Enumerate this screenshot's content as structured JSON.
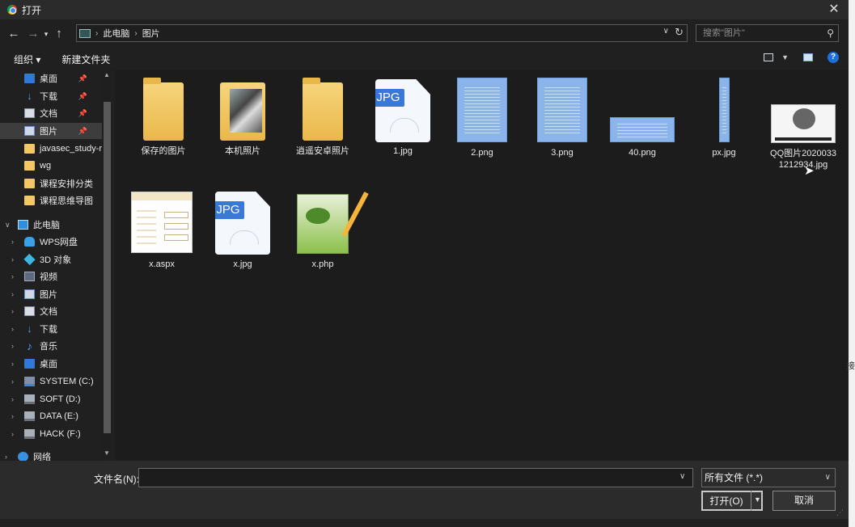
{
  "window": {
    "title": "打开"
  },
  "outside_glyph": "接",
  "address": {
    "crumbs": [
      "此电脑",
      "图片"
    ]
  },
  "search": {
    "placeholder": "搜索\"图片\""
  },
  "toolbar": {
    "organize": "组织 ▾",
    "new_folder": "新建文件夹"
  },
  "sidebar": {
    "quick_access": [
      {
        "label": "桌面",
        "icon": "desktop-icon",
        "pinned": true
      },
      {
        "label": "下载",
        "icon": "download-icon",
        "pinned": true
      },
      {
        "label": "文档",
        "icon": "document-icon",
        "pinned": true
      },
      {
        "label": "图片",
        "icon": "pictures-icon",
        "pinned": true,
        "selected": true
      },
      {
        "label": "javasec_study-r",
        "icon": "folder-icon"
      },
      {
        "label": "wg",
        "icon": "folder-icon"
      },
      {
        "label": "课程安排分类",
        "icon": "folder-icon"
      },
      {
        "label": "课程思维导图",
        "icon": "folder-icon"
      }
    ],
    "this_pc": "此电脑",
    "pc_items": [
      {
        "label": "WPS网盘",
        "icon": "cloud-icon"
      },
      {
        "label": "3D 对象",
        "icon": "3d-objects-icon"
      },
      {
        "label": "视频",
        "icon": "video-icon"
      },
      {
        "label": "图片",
        "icon": "pictures-icon"
      },
      {
        "label": "文档",
        "icon": "document-icon"
      },
      {
        "label": "下载",
        "icon": "download-icon"
      },
      {
        "label": "音乐",
        "icon": "music-icon"
      },
      {
        "label": "桌面",
        "icon": "desktop-icon"
      },
      {
        "label": "SYSTEM (C:)",
        "icon": "system-drive-icon"
      },
      {
        "label": "SOFT (D:)",
        "icon": "drive-icon"
      },
      {
        "label": "DATA (E:)",
        "icon": "drive-icon"
      },
      {
        "label": "HACK (F:)",
        "icon": "drive-icon"
      }
    ],
    "network": "网络"
  },
  "files": [
    {
      "name": "保存的图片",
      "type": "folder"
    },
    {
      "name": "本机照片",
      "type": "folder-photo"
    },
    {
      "name": "逍遥安卓照片",
      "type": "folder"
    },
    {
      "name": "1.jpg",
      "type": "jpg"
    },
    {
      "name": "2.png",
      "type": "doc-tall"
    },
    {
      "name": "3.png",
      "type": "doc-tall"
    },
    {
      "name": "40.png",
      "type": "doc-wide"
    },
    {
      "name": "px.jpg",
      "type": "doc-narrow"
    },
    {
      "name": "QQ图片20200331212934.jpg",
      "type": "qq"
    },
    {
      "name": "x.aspx",
      "type": "aspx"
    },
    {
      "name": "x.jpg",
      "type": "jpg"
    },
    {
      "name": "x.php",
      "type": "npp"
    }
  ],
  "jpg_badge": "JPG",
  "bottom": {
    "filename_label": "文件名(N):",
    "filename_value": "",
    "filter": "所有文件 (*.*)",
    "open": "打开(O)",
    "cancel": "取消"
  }
}
